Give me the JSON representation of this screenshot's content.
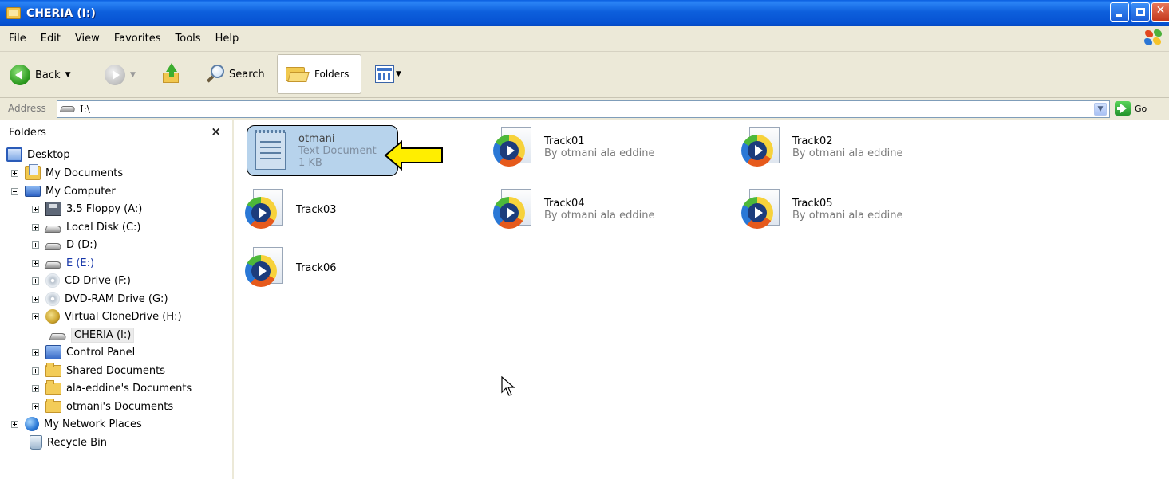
{
  "window": {
    "title": "CHERIA (I:)",
    "controls": {
      "minimize": "_",
      "maximize": "□",
      "close": "✕"
    }
  },
  "menu": [
    "File",
    "Edit",
    "View",
    "Favorites",
    "Tools",
    "Help"
  ],
  "toolbar": {
    "back_label": "Back",
    "search_label": "Search",
    "folders_label": "Folders"
  },
  "address": {
    "label": "Address",
    "value": "I:\\",
    "go_label": "Go"
  },
  "folders_pane": {
    "title": "Folders",
    "close": "×",
    "items": [
      {
        "label": "Desktop"
      },
      {
        "label": "My Documents"
      },
      {
        "label": "My Computer"
      },
      {
        "label": "3.5 Floppy (A:)"
      },
      {
        "label": "Local Disk (C:)"
      },
      {
        "label": "D (D:)"
      },
      {
        "label": "E (E:)"
      },
      {
        "label": "CD Drive (F:)"
      },
      {
        "label": "DVD-RAM Drive (G:)"
      },
      {
        "label": "Virtual CloneDrive (H:)"
      },
      {
        "label": "CHERIA (I:)"
      },
      {
        "label": "Control Panel"
      },
      {
        "label": "Shared Documents"
      },
      {
        "label": "ala-eddine's Documents"
      },
      {
        "label": "otmani's Documents"
      },
      {
        "label": "My Network Places"
      },
      {
        "label": "Recycle Bin"
      }
    ]
  },
  "files": {
    "text_doc": {
      "name": "otmani",
      "type": "Text Document",
      "size": "1 KB"
    },
    "tracks": [
      {
        "name": "Track01",
        "artist": "By otmani ala eddine"
      },
      {
        "name": "Track02",
        "artist": "By otmani ala eddine"
      },
      {
        "name": "Track03",
        "artist": ""
      },
      {
        "name": "Track04",
        "artist": "By otmani ala eddine"
      },
      {
        "name": "Track05",
        "artist": "By otmani ala eddine"
      },
      {
        "name": "Track06",
        "artist": ""
      }
    ]
  },
  "colors": {
    "titlebar": "#0652d2",
    "selection": "#b7d3ec",
    "callout_arrow": "#ffee00",
    "chrome": "#ece9d8"
  }
}
